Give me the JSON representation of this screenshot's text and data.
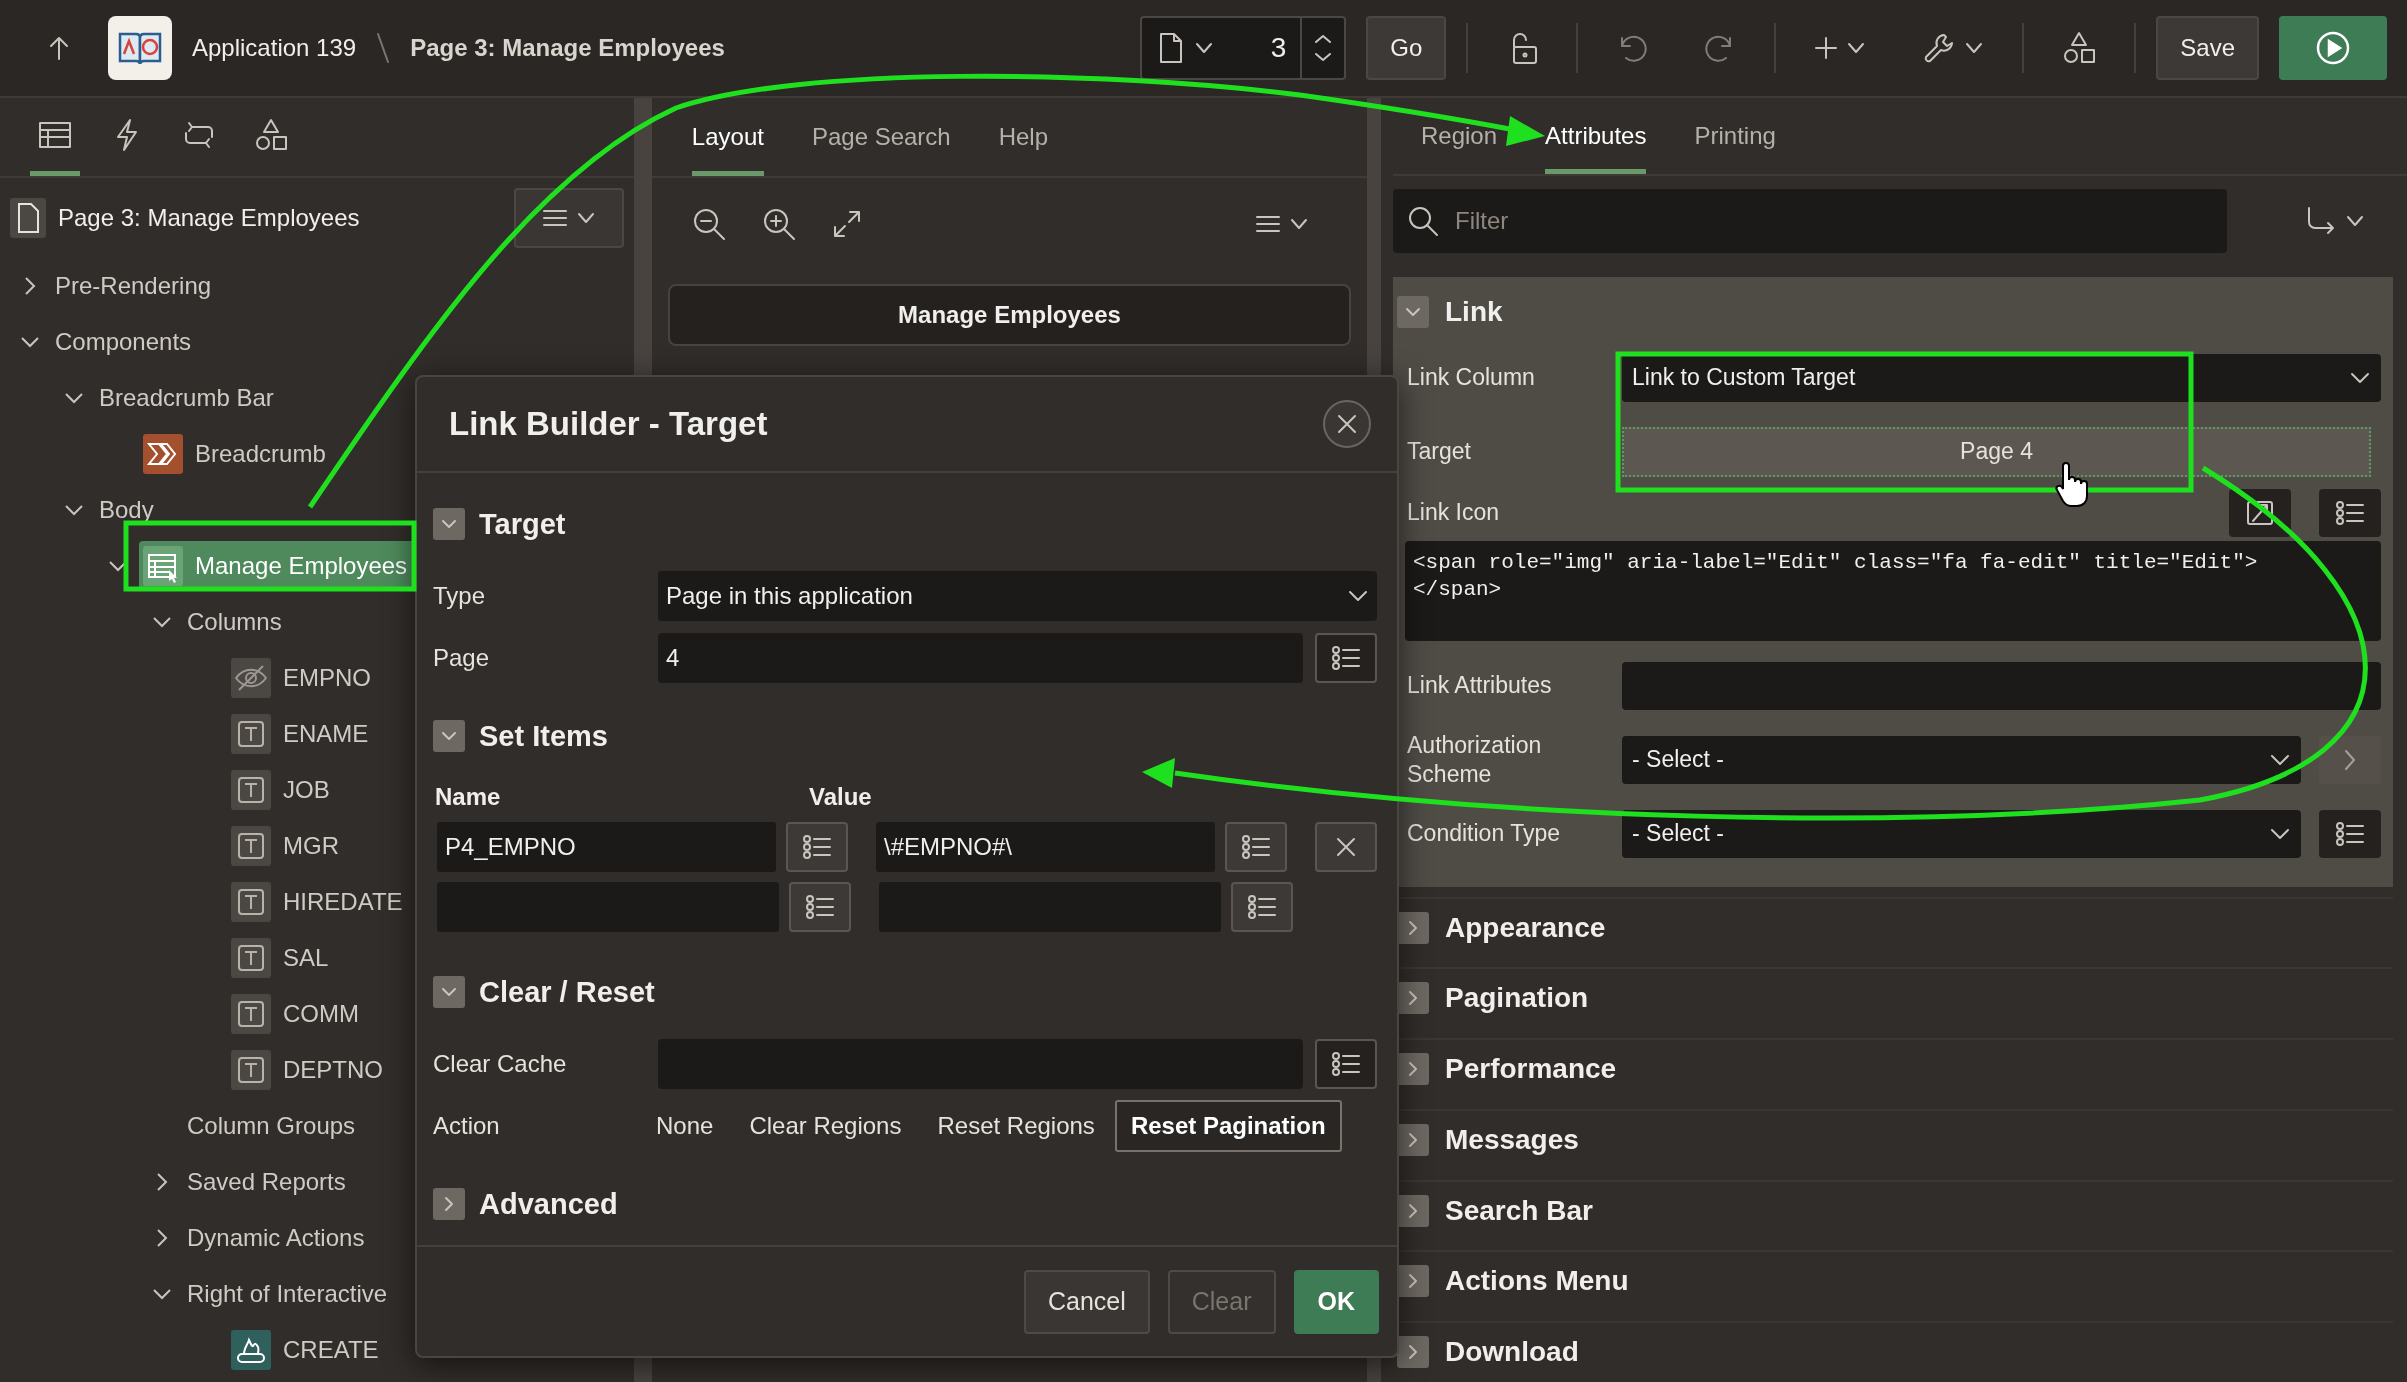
{
  "topbar": {
    "app": "Application 139",
    "page": "Page 3: Manage Employees",
    "page_number": "3",
    "go": "Go",
    "save": "Save"
  },
  "left_panel": {
    "tabs": [
      {
        "kind": "tree",
        "selected": true
      },
      {
        "kind": "lightning",
        "selected": false
      },
      {
        "kind": "refresh",
        "selected": false
      },
      {
        "kind": "shapes",
        "selected": false
      }
    ],
    "tree_title": "Page 3: Manage Employees",
    "tree": [
      {
        "label": "Pre-Rendering",
        "expanded": false,
        "selected": false
      },
      {
        "label": "Components",
        "expanded": true,
        "selected": false,
        "children": [
          {
            "label": "Breadcrumb Bar",
            "expanded": true,
            "selected": false,
            "children": [
              {
                "label": "Breadcrumb",
                "kind": "breadcrumb",
                "selected": false
              }
            ]
          },
          {
            "label": "Body",
            "expanded": true,
            "selected": false,
            "children": [
              {
                "label": "Manage Employees",
                "kind": "report",
                "expanded": true,
                "selected": true,
                "children": [
                  {
                    "label": "Columns",
                    "expanded": true,
                    "selected": false,
                    "children": [
                      {
                        "label": "EMPNO",
                        "kind": "hidden",
                        "selected": false
                      },
                      {
                        "label": "ENAME",
                        "kind": "text",
                        "selected": false
                      },
                      {
                        "label": "JOB",
                        "kind": "text",
                        "selected": false
                      },
                      {
                        "label": "MGR",
                        "kind": "text",
                        "selected": false
                      },
                      {
                        "label": "HIREDATE",
                        "kind": "text",
                        "selected": false
                      },
                      {
                        "label": "SAL",
                        "kind": "text",
                        "selected": false
                      },
                      {
                        "label": "COMM",
                        "kind": "text",
                        "selected": false
                      },
                      {
                        "label": "DEPTNO",
                        "kind": "text",
                        "selected": false
                      }
                    ]
                  },
                  {
                    "label": "Column Groups",
                    "selected": false
                  },
                  {
                    "label": "Saved Reports",
                    "expanded": false,
                    "selected": false
                  },
                  {
                    "label": "Dynamic Actions",
                    "expanded": false,
                    "selected": false
                  },
                  {
                    "label": "Right of Interactive",
                    "expanded": true,
                    "selected": false,
                    "children": [
                      {
                        "label": "CREATE",
                        "kind": "button",
                        "selected": false
                      }
                    ]
                  }
                ]
              }
            ]
          }
        ]
      }
    ]
  },
  "layout_panel": {
    "tabs": [
      {
        "label": "Layout",
        "selected": true
      },
      {
        "label": "Page Search",
        "selected": false
      },
      {
        "label": "Help",
        "selected": false
      }
    ],
    "region_title": "Manage Employees"
  },
  "property_panel": {
    "tabs": [
      {
        "label": "Region",
        "selected": false
      },
      {
        "label": "Attributes",
        "selected": true
      },
      {
        "label": "Printing",
        "selected": false
      }
    ],
    "filter": {
      "placeholder": "Filter"
    },
    "groups": [
      {
        "title": "Link",
        "expanded": true,
        "properties": [
          {
            "label": "Link Column",
            "kind": "select",
            "value": "Link to Custom Target"
          },
          {
            "label": "Target",
            "kind": "link-button",
            "value": "Page 4"
          },
          {
            "label": "Link Icon",
            "kind": "code",
            "value": "<span role=\"img\" aria-label=\"Edit\" class=\"fa fa-edit\" title=\"Edit\">\n</span>",
            "actions": [
              {
                "kind": "icon-picker",
                "disabled": false
              },
              {
                "kind": "list",
                "disabled": false
              }
            ]
          },
          {
            "label": "Link Attributes",
            "kind": "text"
          },
          {
            "label": "Authorization Scheme",
            "kind": "select",
            "value": "- Select -",
            "actions": [
              {
                "kind": "next",
                "disabled": true
              }
            ]
          },
          {
            "label": "Condition Type",
            "kind": "select",
            "value": "- Select -",
            "actions": [
              {
                "kind": "list",
                "disabled": false
              }
            ]
          }
        ]
      },
      {
        "title": "Appearance",
        "expanded": false
      },
      {
        "title": "Pagination",
        "expanded": false
      },
      {
        "title": "Performance",
        "expanded": false
      },
      {
        "title": "Messages",
        "expanded": false
      },
      {
        "title": "Search Bar",
        "expanded": false
      },
      {
        "title": "Actions Menu",
        "expanded": false
      },
      {
        "title": "Download",
        "expanded": false
      }
    ]
  },
  "dialog": {
    "title": "Link Builder - Target",
    "sections": [
      {
        "title": "Target",
        "expanded": true,
        "kind": "fields",
        "fields": [
          {
            "label": "Type",
            "kind": "select",
            "value": "Page in this application"
          },
          {
            "label": "Page",
            "kind": "text-list",
            "value": "4"
          }
        ]
      },
      {
        "title": "Set Items",
        "expanded": true,
        "kind": "items",
        "columns": [
          "Name",
          "Value"
        ],
        "rows": [
          {
            "name": "P4_EMPNO",
            "value": "\\#EMPNO#\\",
            "removable": true
          },
          {
            "removable": false
          }
        ]
      },
      {
        "title": "Clear / Reset",
        "expanded": true,
        "kind": "fields",
        "fields": [
          {
            "label": "Clear Cache",
            "kind": "text-list"
          },
          {
            "label": "Action",
            "kind": "radio",
            "options": [
              {
                "label": "None",
                "selected": false
              },
              {
                "label": "Clear Regions",
                "selected": false
              },
              {
                "label": "Reset Regions",
                "selected": false
              },
              {
                "label": "Reset Pagination",
                "selected": true
              }
            ]
          }
        ]
      },
      {
        "title": "Advanced",
        "expanded": false
      }
    ],
    "buttons": [
      {
        "label": "Cancel",
        "kind": "default",
        "disabled": false
      },
      {
        "label": "Clear",
        "kind": "default",
        "disabled": true
      },
      {
        "label": "OK",
        "kind": "primary",
        "disabled": false
      }
    ]
  }
}
